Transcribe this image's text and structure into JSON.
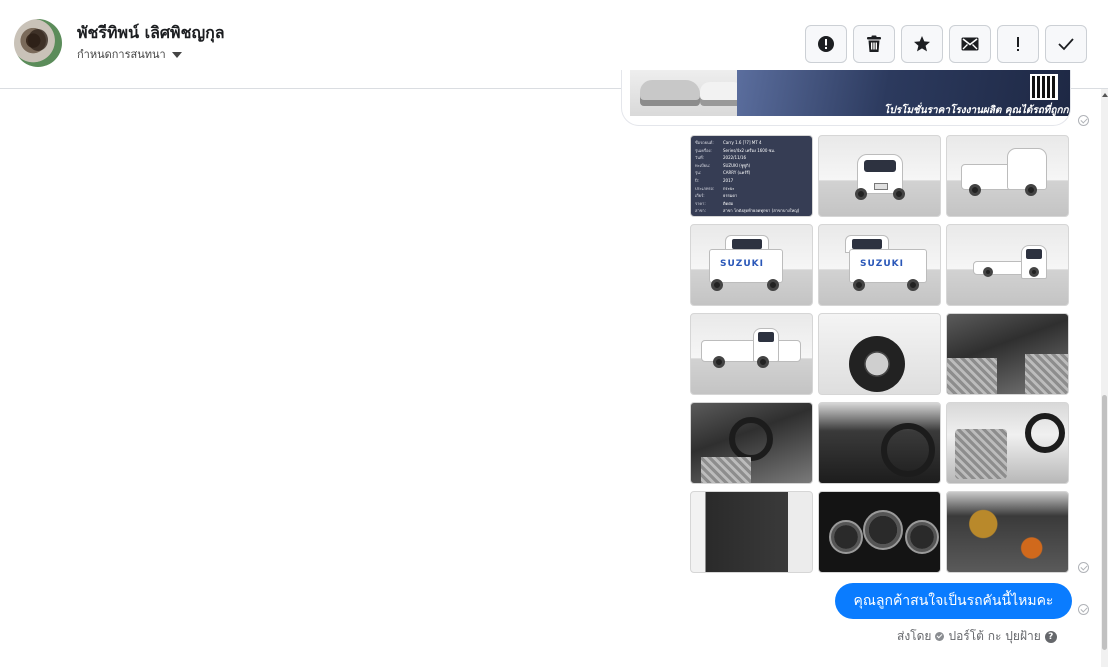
{
  "header": {
    "contact_name": "พัชรีทิพน์ เลิศพิชญกุล",
    "assign_label": "กำหนดการสนทนา",
    "actions": [
      {
        "icon": "alert-circle-icon"
      },
      {
        "icon": "trash-icon"
      },
      {
        "icon": "star-icon"
      },
      {
        "icon": "mail-icon"
      },
      {
        "icon": "exclamation-icon"
      },
      {
        "icon": "check-icon"
      }
    ]
  },
  "promo": {
    "text": "โปรโมชั่นราคาโรงงานผลิต คุณได้รถที่ถูกกว่า"
  },
  "spec_card": {
    "rows": [
      {
        "k": "ชื่อรถยนต์:",
        "v": "Carry 1.6 [?7] MT 4"
      },
      {
        "k": "รุ่นเครื่อง:",
        "v": "Series/4x2 เครื่อง 1600 ซม."
      },
      {
        "k": "วันที่:",
        "v": "2022/11/16"
      },
      {
        "k": "ทะเบียน:",
        "v": "SUZUKI (ซูซูกิ)"
      },
      {
        "k": "รุ่น:",
        "v": "CARRY (แคร์รี่)"
      },
      {
        "k": "ปี:",
        "v": "2017"
      },
      {
        "k": "ประเภทรถ:",
        "v": "กระบะ"
      },
      {
        "k": "เกียร์:",
        "v": "ธรรมดา"
      },
      {
        "k": "ราคา:",
        "v": "ติดต่อ"
      },
      {
        "k": "สาขา:",
        "v": "สาขา โกดังสุดท้ายลดทุกขา (สาขาบางใหญ่)"
      }
    ]
  },
  "message": {
    "text": "คุณลูกค้าสนใจเป็นรถคันนี้ไหมคะ",
    "sent_by_label": "ส่งโดย",
    "sender": "ปอร์โต้ กะ ปุยฝ้าย"
  },
  "colors": {
    "bubble": "#0a7cff",
    "spec_bg": "#363d54"
  }
}
